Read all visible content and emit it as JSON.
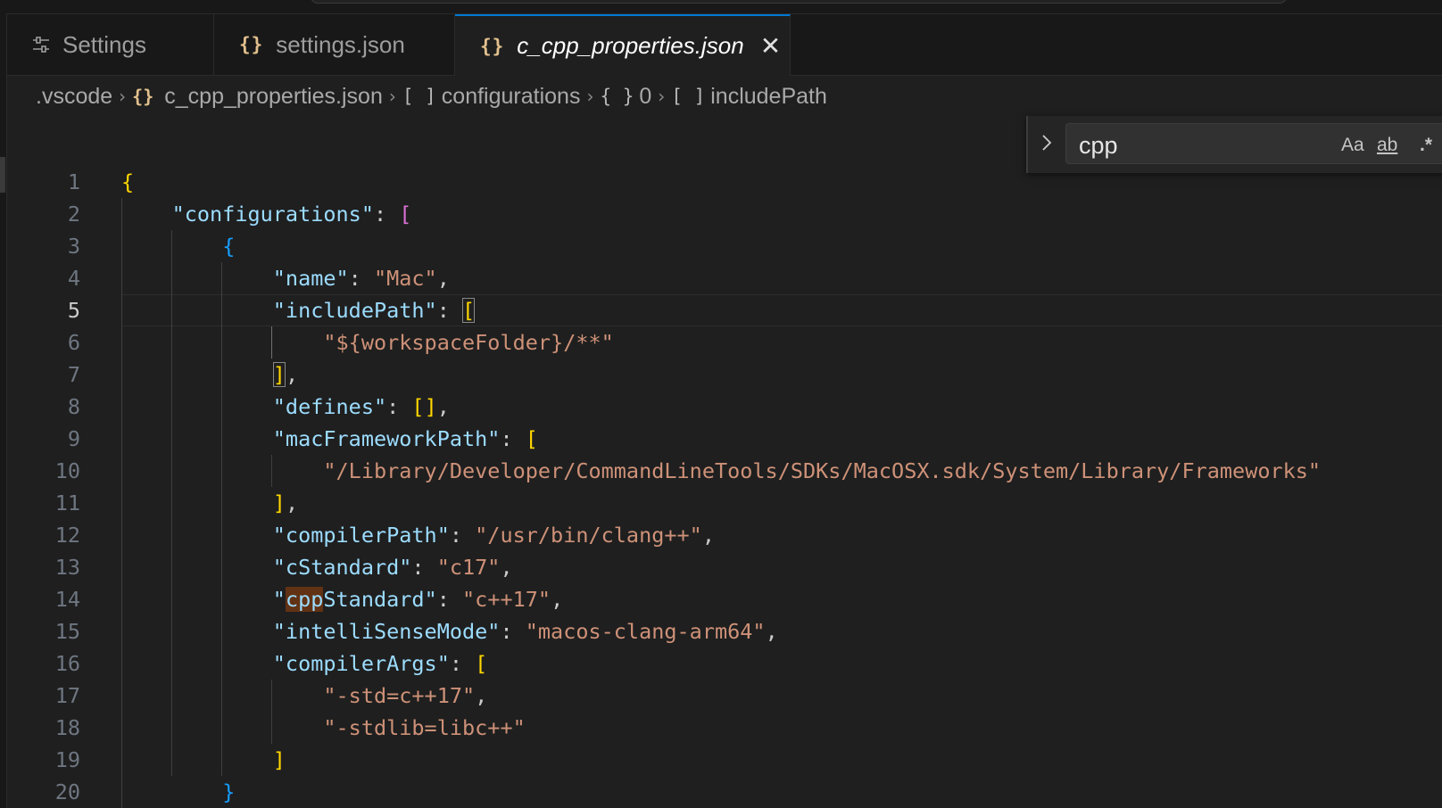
{
  "tabs": [
    {
      "label": "Settings",
      "icon": "settings-icon"
    },
    {
      "label": "settings.json",
      "icon": "json-braces-icon"
    },
    {
      "label": "c_cpp_properties.json",
      "icon": "json-braces-icon",
      "active": true
    }
  ],
  "json_icon_text": "{}",
  "close_glyph": "✕",
  "breadcrumb": {
    "folder": ".vscode",
    "file": "c_cpp_properties.json",
    "array_symbol": "[ ]",
    "object_symbol": "{ }",
    "configurations": "configurations",
    "index": "0",
    "include_path": "includePath",
    "separator": "›"
  },
  "find": {
    "query": "cpp",
    "match_case_label": "Aa",
    "whole_word_label": "ab",
    "regex_label": ".*",
    "toggle_icon": "chevron-right-icon"
  },
  "editor": {
    "active_line": 5,
    "line_numbers": [
      "1",
      "2",
      "3",
      "4",
      "5",
      "6",
      "7",
      "8",
      "9",
      "10",
      "11",
      "12",
      "13",
      "14",
      "15",
      "16",
      "17",
      "18",
      "19",
      "20"
    ],
    "colors": {
      "key": "#9cdcfe",
      "string": "#ce9178",
      "bracket_gold": "#ffd700",
      "bracket_purple": "#da70d6",
      "bracket_blue": "#179fff",
      "find_highlight": "#613214",
      "accent": "#0078d4"
    },
    "lines": [
      [
        [
          "{",
          "b1"
        ]
      ],
      [
        [
          "    ",
          "p"
        ],
        [
          "\"configurations\"",
          "k"
        ],
        [
          ": ",
          "p"
        ],
        [
          "[",
          "b2"
        ]
      ],
      [
        [
          "        ",
          "p"
        ],
        [
          "{",
          "b3"
        ]
      ],
      [
        [
          "            ",
          "p"
        ],
        [
          "\"name\"",
          "k"
        ],
        [
          ": ",
          "p"
        ],
        [
          "\"Mac\"",
          "s"
        ],
        [
          ",",
          "p"
        ]
      ],
      [
        [
          "            ",
          "p"
        ],
        [
          "\"includePath\"",
          "k"
        ],
        [
          ": ",
          "p"
        ],
        [
          "[",
          "b1 bm"
        ]
      ],
      [
        [
          "                ",
          "p"
        ],
        [
          "\"${workspaceFolder}/**\"",
          "s"
        ]
      ],
      [
        [
          "            ",
          "p"
        ],
        [
          "]",
          "b1 bm"
        ],
        [
          ",",
          "p"
        ]
      ],
      [
        [
          "            ",
          "p"
        ],
        [
          "\"defines\"",
          "k"
        ],
        [
          ": ",
          "p"
        ],
        [
          "[]",
          "b1"
        ],
        [
          ",",
          "p"
        ]
      ],
      [
        [
          "            ",
          "p"
        ],
        [
          "\"macFrameworkPath\"",
          "k"
        ],
        [
          ": ",
          "p"
        ],
        [
          "[",
          "b1"
        ]
      ],
      [
        [
          "                ",
          "p"
        ],
        [
          "\"/Library/Developer/CommandLineTools/SDKs/MacOSX.sdk/System/Library/Frameworks\"",
          "s"
        ]
      ],
      [
        [
          "            ",
          "p"
        ],
        [
          "]",
          "b1"
        ],
        [
          ",",
          "p"
        ]
      ],
      [
        [
          "            ",
          "p"
        ],
        [
          "\"compilerPath\"",
          "k"
        ],
        [
          ": ",
          "p"
        ],
        [
          "\"/usr/bin/clang++\"",
          "s"
        ],
        [
          ",",
          "p"
        ]
      ],
      [
        [
          "            ",
          "p"
        ],
        [
          "\"cStandard\"",
          "k"
        ],
        [
          ": ",
          "p"
        ],
        [
          "\"c17\"",
          "s"
        ],
        [
          ",",
          "p"
        ]
      ],
      [
        [
          "            ",
          "p"
        ],
        [
          "\"",
          "k"
        ],
        [
          "cpp",
          "k hl"
        ],
        [
          "Standard\"",
          "k"
        ],
        [
          ": ",
          "p"
        ],
        [
          "\"c++17\"",
          "s"
        ],
        [
          ",",
          "p"
        ]
      ],
      [
        [
          "            ",
          "p"
        ],
        [
          "\"intelliSenseMode\"",
          "k"
        ],
        [
          ": ",
          "p"
        ],
        [
          "\"macos-clang-arm64\"",
          "s"
        ],
        [
          ",",
          "p"
        ]
      ],
      [
        [
          "            ",
          "p"
        ],
        [
          "\"compilerArgs\"",
          "k"
        ],
        [
          ": ",
          "p"
        ],
        [
          "[",
          "b1"
        ]
      ],
      [
        [
          "                ",
          "p"
        ],
        [
          "\"-std=c++17\"",
          "s"
        ],
        [
          ",",
          "p"
        ]
      ],
      [
        [
          "                ",
          "p"
        ],
        [
          "\"-stdlib=libc++\"",
          "s"
        ]
      ],
      [
        [
          "            ",
          "p"
        ],
        [
          "]",
          "b1"
        ]
      ],
      [
        [
          "        ",
          "p"
        ],
        [
          "}",
          "b3"
        ]
      ]
    ]
  }
}
